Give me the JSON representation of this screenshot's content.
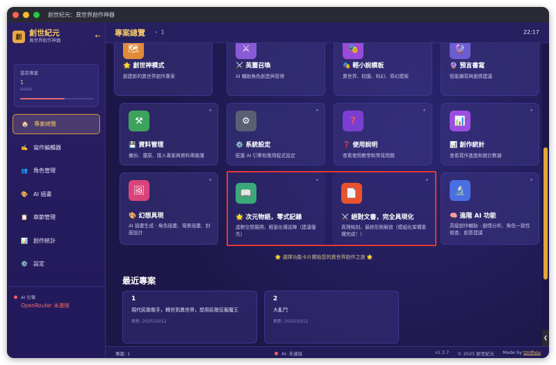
{
  "window": {
    "title": "創世紀元：異世界創作神器"
  },
  "brand": {
    "logo": "創",
    "name": "創世紀元",
    "subtitle": "異世界創作神器"
  },
  "current_project": {
    "label": "當前專案",
    "number": "1",
    "subtitle": "Isekai",
    "progress": 0.6
  },
  "nav": {
    "items": [
      {
        "label": "專案總覽",
        "icon": "🏠"
      },
      {
        "label": "寫作編輯器",
        "icon": "✍️"
      },
      {
        "label": "角色管理",
        "icon": "👥"
      },
      {
        "label": "AI 插畫",
        "icon": "🎨"
      },
      {
        "label": "章節管理",
        "icon": "📋"
      },
      {
        "label": "創作統計",
        "icon": "📊"
      },
      {
        "label": "設定",
        "icon": "⚙️"
      }
    ]
  },
  "engine": {
    "label": "AI 引擎",
    "status": "OpenRouter 未連接"
  },
  "header": {
    "title": "專案總覽",
    "count": "・ 1",
    "time": "22:17"
  },
  "cards": [
    {
      "title": "🌟 創世神模式",
      "desc": "創建新的異世界創作專案",
      "icon": "🗺"
    },
    {
      "title": "⚔️ 英靈召喚",
      "desc": "AI 輔助角色創造與管理",
      "icon": "⚔"
    },
    {
      "title": "🎭 輕小說模板",
      "desc": "異世界、校園、科幻、奇幻模板",
      "icon": "🎭"
    },
    {
      "title": "🔮 預言書寫",
      "desc": "智能續寫與劇情建議",
      "icon": "🔮"
    },
    {
      "title": "💾 資料管理",
      "desc": "備份、還原、匯入專案與資料庫維護",
      "icon": "⚒"
    },
    {
      "title": "⚙️ 系統設定",
      "desc": "配置 AI 引擎和應用程式設定",
      "icon": "⚙"
    },
    {
      "title": "❓ 使用說明",
      "desc": "查看使用教學和常見問題",
      "icon": "?"
    },
    {
      "title": "📊 創作統計",
      "desc": "查看寫作進度和統計數據",
      "icon": "📊"
    },
    {
      "title": "🎨 幻想具現",
      "desc": "AI 插畫生成 - 角色插畫、場景插畫、封面設計",
      "icon": "🖼"
    },
    {
      "title": "🌟 次元物語，零式記錄",
      "desc": "虛數空間展開，輕量化傳送陣（建議優先）",
      "icon": "📖"
    },
    {
      "title": "⚔️ 絕對文書，完全具現化",
      "desc": "真理銘刻，最終形態解放（模組化架構重構完成！）",
      "icon": "📄"
    },
    {
      "title": "🧠 進階 AI 功能",
      "desc": "高級創作輔助 - 劇情分析、角色一致性檢查、創意建議",
      "icon": "🔬"
    }
  ],
  "hint": "🌟 選擇功能卡片開始您的異世界創作之旅 🌟",
  "recent": {
    "title": "最近專案",
    "items": [
      {
        "num": "1",
        "title": "現代民歌歌手，轉世到異世界，想用民歌征服魔王",
        "date": "更新: 2025/10/12"
      },
      {
        "num": "2",
        "title": "大亂鬥",
        "date": "更新: 2025/10/11"
      }
    ]
  },
  "footer": {
    "projects": "專案: 1",
    "ai_status": "AI: 未連接",
    "version": "v1.3.7",
    "copyright": "© 2025 創世紀元",
    "made_by": "Made by",
    "author": "tznthou"
  },
  "colors": {
    "accent": "#f5c66a",
    "highlight": "#e53935",
    "bg": "#1c1745"
  }
}
